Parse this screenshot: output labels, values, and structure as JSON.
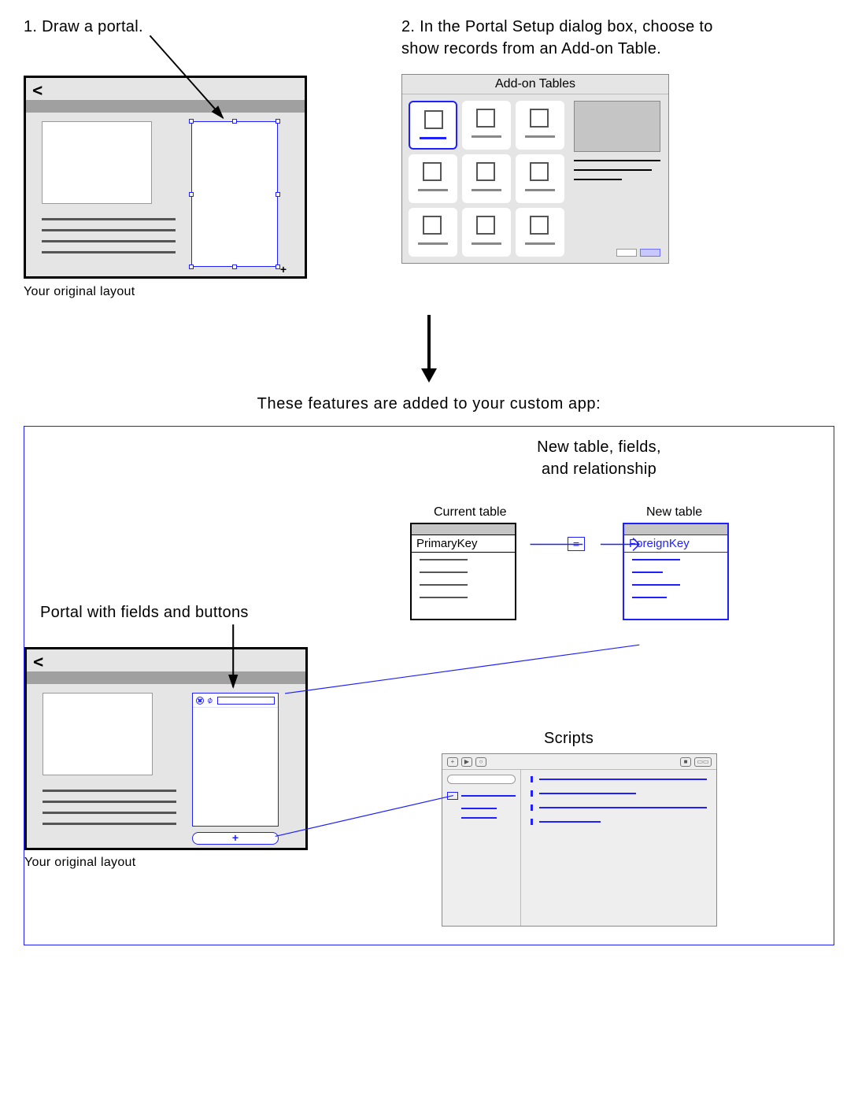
{
  "step1": {
    "text": "1. Draw a portal.",
    "caption": "Your original layout",
    "back_glyph": "<"
  },
  "step2": {
    "text": "2. In the Portal Setup dialog box, choose to show records from an Add-on Table.",
    "dialog_title": "Add-on Tables"
  },
  "features": {
    "title": "These features are added to your custom app:",
    "relationship": {
      "heading_line1": "New table, fields,",
      "heading_line2": "and relationship",
      "current_label": "Current table",
      "new_label": "New table",
      "current_key": "PrimaryKey",
      "new_key": "ForeignKey",
      "operator": "="
    },
    "portal_caption": "Portal with fields and buttons",
    "layout_caption": "Your original layout",
    "add_button_glyph": "+",
    "scripts_caption": "Scripts"
  }
}
